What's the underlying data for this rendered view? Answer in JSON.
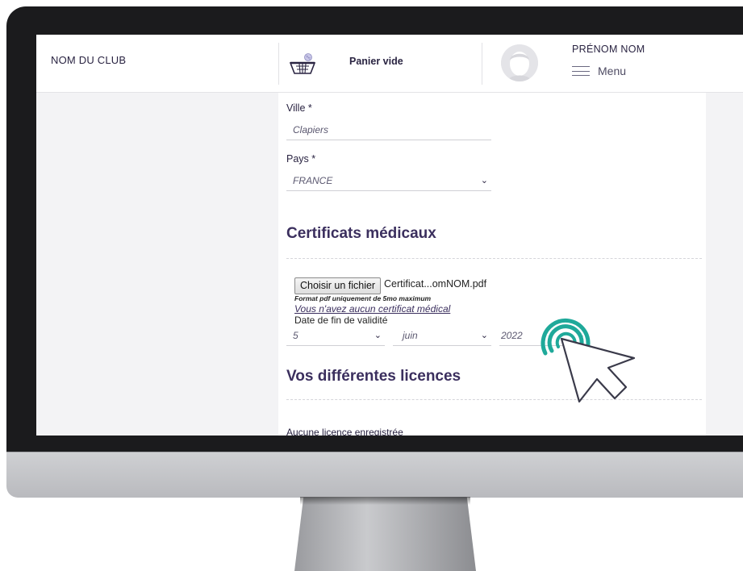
{
  "header": {
    "club_name": "NOM DU CLUB",
    "cart_label": "Panier vide",
    "user_name": "PRÉNOM NOM",
    "menu_label": "Menu"
  },
  "form": {
    "city_label": "Ville *",
    "city_value": "Clapiers",
    "country_label": "Pays *",
    "country_value": "FRANCE",
    "certificates_heading": "Certificats médicaux",
    "choose_file_label": "Choisir un fichier",
    "file_name": "Certificat...omNOM.pdf",
    "file_hint": "Format pdf uniquement de 5mo maximum",
    "no_certificate_link": "Vous n'avez aucun certificat médical",
    "validity_label": "Date de fin de validité",
    "day_value": "5",
    "month_value": "juin",
    "year_value": "2022",
    "licences_heading": "Vos différentes licences",
    "no_licence_text": "Aucune licence enregistrée"
  },
  "colors": {
    "accent": "#3b2f5e",
    "click_ring": "#1fa99a",
    "monitor_bezel": "#1b1b1d"
  }
}
